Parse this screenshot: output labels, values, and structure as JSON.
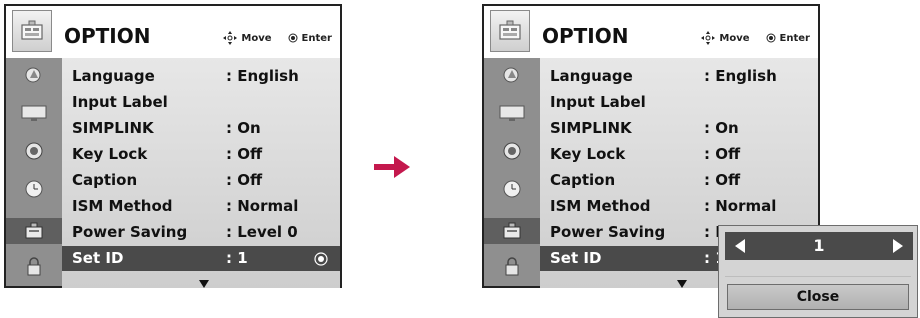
{
  "screens": [
    {
      "menu": {
        "title": "OPTION",
        "hints": {
          "move": "Move",
          "enter": "Enter"
        },
        "sidebar_icons": [
          "picture-icon",
          "screen-icon",
          "audio-icon",
          "time-icon",
          "option-icon",
          "lock-icon"
        ],
        "active_icon_index": 4,
        "rows": [
          {
            "label": "Language",
            "value": ": English"
          },
          {
            "label": "Input Label",
            "value": ""
          },
          {
            "label": "SIMPLINK",
            "value": ": On"
          },
          {
            "label": "Key Lock",
            "value": ": Off"
          },
          {
            "label": "Caption",
            "value": ": Off"
          },
          {
            "label": "ISM Method",
            "value": ": Normal"
          },
          {
            "label": "Power Saving",
            "value": ": Level 0"
          },
          {
            "label": "Set ID",
            "value": ": 1",
            "selected": true
          }
        ]
      }
    },
    {
      "menu": {
        "title": "OPTION",
        "hints": {
          "move": "Move",
          "enter": "Enter"
        },
        "rows": [
          {
            "label": "Language",
            "value": ": English"
          },
          {
            "label": "Input Label",
            "value": ""
          },
          {
            "label": "SIMPLINK",
            "value": ": On"
          },
          {
            "label": "Key Lock",
            "value": ": Off"
          },
          {
            "label": "Caption",
            "value": ": Off"
          },
          {
            "label": "ISM Method",
            "value": ": Normal"
          },
          {
            "label": "Power Saving",
            "value": ": L"
          },
          {
            "label": "Set ID",
            "value": ": 1",
            "selected": true
          }
        ]
      },
      "popup": {
        "value": "1",
        "close_label": "Close"
      }
    }
  ],
  "colors": {
    "selected_row": "#4a4a4a",
    "sidebar": "#8f8f8f",
    "transition_arrow": "#c4184d"
  },
  "transition": "arrow-right"
}
